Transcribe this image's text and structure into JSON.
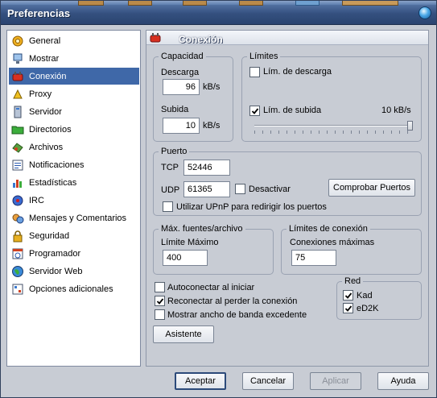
{
  "window": {
    "title": "Preferencias"
  },
  "colors": {
    "selection": "#3f68a8",
    "title_bar": "#34507f",
    "panel_bg": "#c8ccd4"
  },
  "sidebar": {
    "items": [
      {
        "label": "General",
        "icon": "gear-icon"
      },
      {
        "label": "Mostrar",
        "icon": "display-icon"
      },
      {
        "label": "Conexión",
        "icon": "plug-icon",
        "selected": true
      },
      {
        "label": "Proxy",
        "icon": "proxy-icon"
      },
      {
        "label": "Servidor",
        "icon": "server-icon"
      },
      {
        "label": "Directorios",
        "icon": "folder-icon"
      },
      {
        "label": "Archivos",
        "icon": "files-icon"
      },
      {
        "label": "Notificaciones",
        "icon": "notification-icon"
      },
      {
        "label": "Estadísticas",
        "icon": "statistics-icon"
      },
      {
        "label": "IRC",
        "icon": "irc-icon"
      },
      {
        "label": "Mensajes y Comentarios",
        "icon": "messages-icon"
      },
      {
        "label": "Seguridad",
        "icon": "lock-icon"
      },
      {
        "label": "Programador",
        "icon": "scheduler-icon"
      },
      {
        "label": "Servidor Web",
        "icon": "globe-icon"
      },
      {
        "label": "Opciones adicionales",
        "icon": "options-icon"
      }
    ]
  },
  "panel": {
    "title": "Conexión",
    "capacidad": {
      "legend": "Capacidad",
      "descarga_label": "Descarga",
      "descarga_value": "96",
      "subida_label": "Subida",
      "subida_value": "10",
      "unit": "kB/s"
    },
    "limites": {
      "legend": "Límites",
      "lim_descarga_label": "Lím. de descarga",
      "lim_descarga_checked": false,
      "lim_subida_label": "Lím. de subida",
      "lim_subida_checked": true,
      "lim_subida_value": "10 kB/s",
      "slider_level": 1.0
    },
    "puerto": {
      "legend": "Puerto",
      "tcp_label": "TCP",
      "tcp_value": "52446",
      "udp_label": "UDP",
      "udp_value": "61365",
      "desactivar_label": "Desactivar",
      "desactivar_checked": false,
      "comprobar_button": "Comprobar Puertos",
      "upnp_label": "Utilizar UPnP para redirigir los puertos",
      "upnp_checked": false
    },
    "fuentes": {
      "legend": "Máx. fuentes/archivo",
      "limite_label": "Límite Máximo",
      "limite_value": "400"
    },
    "limites_conexion": {
      "legend": "Límites de conexión",
      "conexiones_label": "Conexiones máximas",
      "conexiones_value": "75"
    },
    "options": {
      "autoconectar_label": "Autoconectar al iniciar",
      "autoconectar_checked": false,
      "reconectar_label": "Reconectar al perder la conexión",
      "reconectar_checked": true,
      "mostrar_label": "Mostrar ancho de banda excedente",
      "mostrar_checked": false
    },
    "red": {
      "legend": "Red",
      "kad_label": "Kad",
      "kad_checked": true,
      "ed2k_label": "eD2K",
      "ed2k_checked": true
    },
    "asistente_button": "Asistente"
  },
  "footer": {
    "accept": "Aceptar",
    "cancel": "Cancelar",
    "apply": "Aplicar",
    "help": "Ayuda"
  }
}
